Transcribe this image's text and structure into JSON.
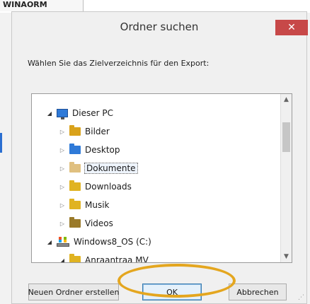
{
  "background": {
    "tab_label": "WINAORM",
    "accent_color": "#2b6fd1"
  },
  "dialog": {
    "title": "Ordner suchen",
    "close_label": "✕",
    "prompt": "Wählen Sie das Zielverzeichnis für den Export:"
  },
  "tree": {
    "items": [
      {
        "label": "Dieser PC",
        "icon": "pc-icon",
        "expanded": true
      },
      {
        "label": "Bilder",
        "icon": "folder-icon",
        "color": "#d9a21b"
      },
      {
        "label": "Desktop",
        "icon": "folder-icon",
        "color": "#2f7ad8"
      },
      {
        "label": "Dokumente",
        "icon": "folder-icon",
        "color": "#e0c080",
        "selected": true
      },
      {
        "label": "Downloads",
        "icon": "folder-icon",
        "color": "#e0b321"
      },
      {
        "label": "Musik",
        "icon": "folder-icon",
        "color": "#e0b321"
      },
      {
        "label": "Videos",
        "icon": "folder-icon",
        "color": "#9a7a2a"
      },
      {
        "label": "Windows8_OS (C:)",
        "icon": "drive-icon",
        "expanded": true
      },
      {
        "label": "Anraantraa MV",
        "icon": "folder-icon",
        "color": "#e0b321",
        "expanded": true
      }
    ]
  },
  "buttons": {
    "new_folder": "Neuen Ordner erstellen",
    "ok": "OK",
    "cancel": "Abbrechen"
  },
  "annotation": {
    "ellipse_color": "#e4a61f"
  }
}
